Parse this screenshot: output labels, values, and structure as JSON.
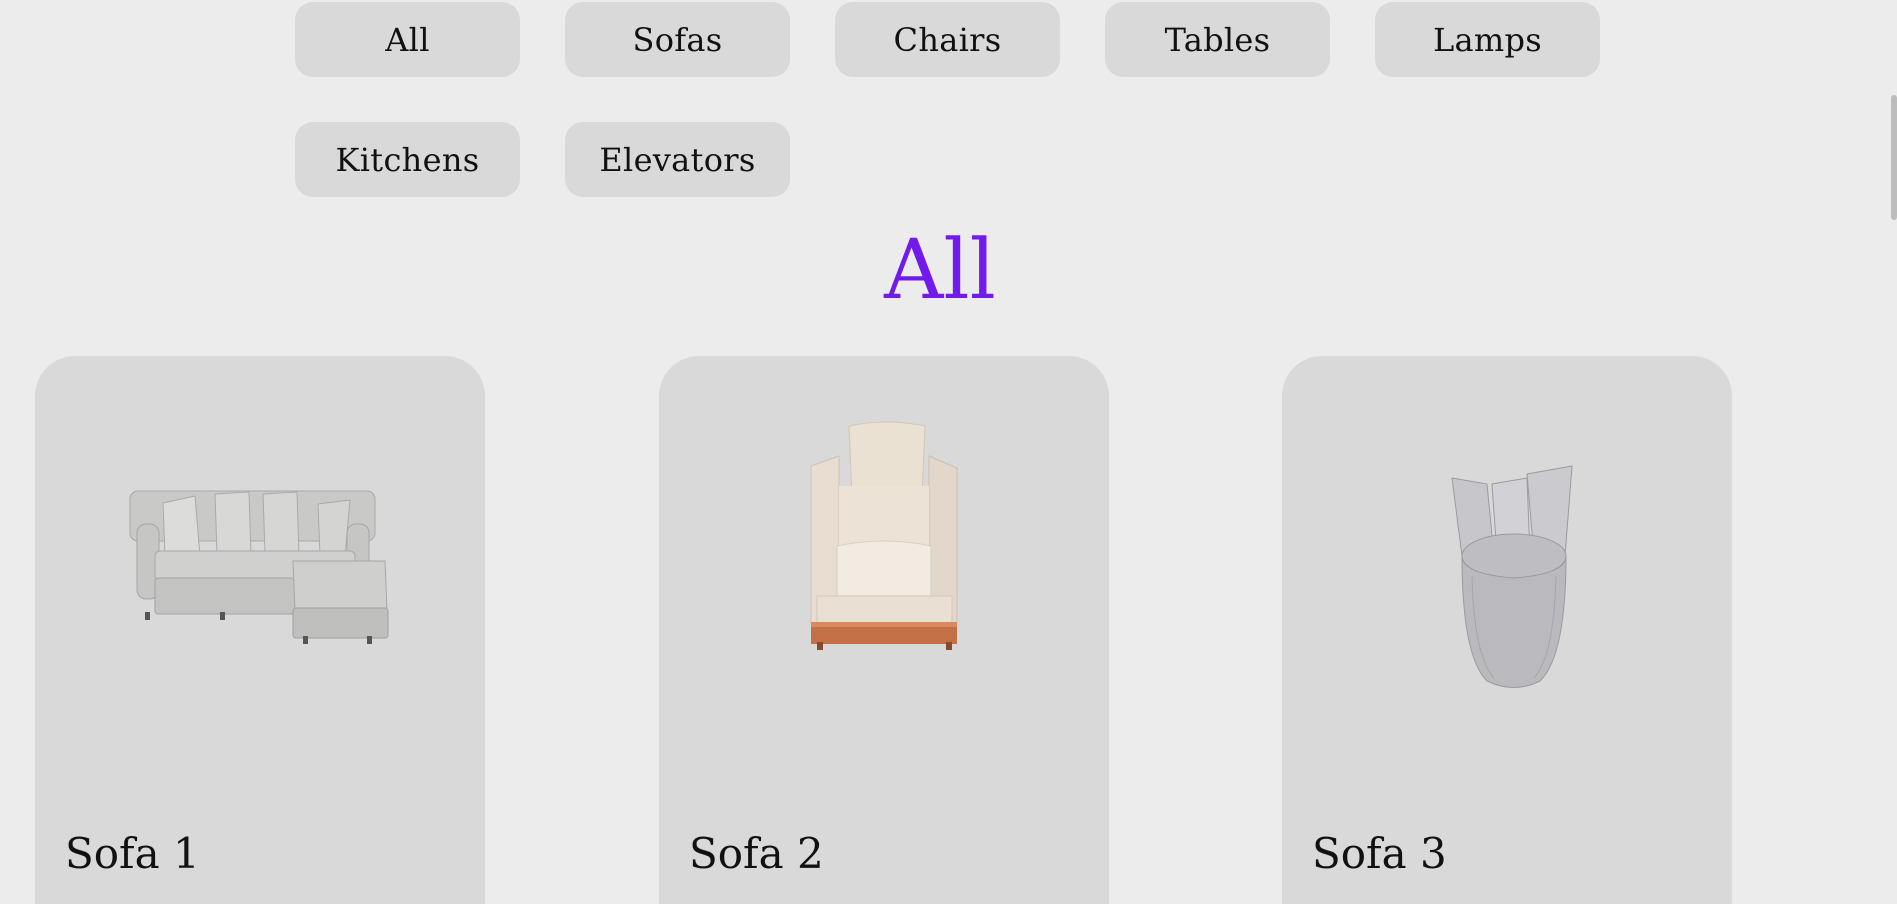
{
  "filters": [
    {
      "label": "All"
    },
    {
      "label": "Sofas"
    },
    {
      "label": "Chairs"
    },
    {
      "label": "Tables"
    },
    {
      "label": "Lamps"
    },
    {
      "label": "Kitchens"
    },
    {
      "label": "Elevators"
    }
  ],
  "heading": "All",
  "products": [
    {
      "title": "Sofa 1",
      "image": "sectional-sofa-image"
    },
    {
      "title": "Sofa 2",
      "image": "armchair-image"
    },
    {
      "title": "Sofa 3",
      "image": "round-chair-image"
    }
  ],
  "colors": {
    "heading_start": "#5a1cf0",
    "heading_end": "#8a18e8",
    "button_bg": "#d9d9d9",
    "page_bg": "#ececec"
  }
}
